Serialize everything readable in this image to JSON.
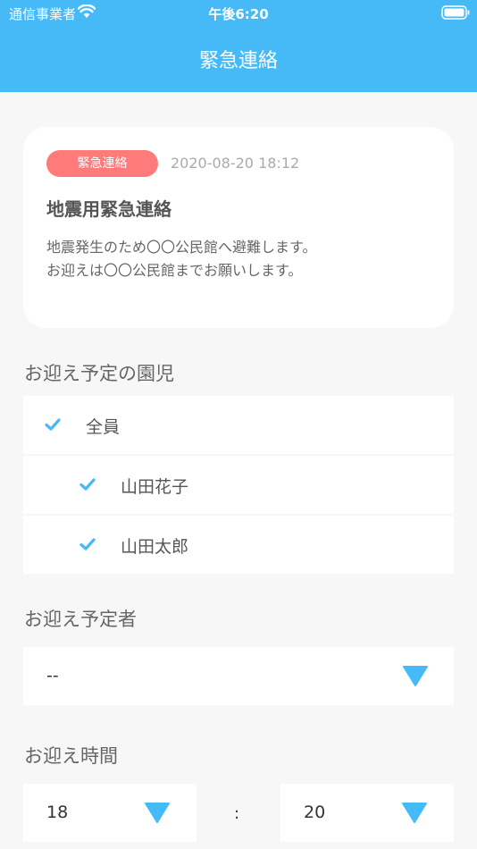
{
  "status_bar": {
    "carrier": "通信事業者",
    "time": "午後6:20"
  },
  "nav": {
    "title": "緊急連絡"
  },
  "card": {
    "badge": "緊急連絡",
    "date": "2020-08-20 18:12",
    "title": "地震用緊急連絡",
    "body_lines": [
      "地震発生のため〇〇公民館へ避難します。",
      "お迎えは〇〇公民館までお願いします。"
    ]
  },
  "children_section": {
    "label": "お迎え予定の園児",
    "items": [
      {
        "label": "全員",
        "checked": true
      },
      {
        "label": "山田花子",
        "checked": true
      },
      {
        "label": "山田太郎",
        "checked": true
      }
    ]
  },
  "pickup_person": {
    "label": "お迎え予定者",
    "value": "--"
  },
  "pickup_time": {
    "label": "お迎え時間",
    "hour": "18",
    "separator": ":",
    "minute": "20"
  },
  "colors": {
    "accent": "#46baf7",
    "badge": "#ff7b7b"
  }
}
